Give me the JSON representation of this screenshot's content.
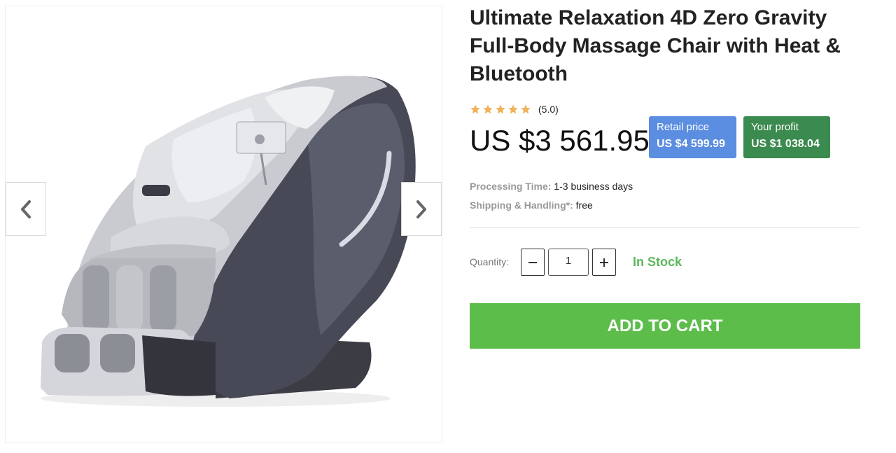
{
  "product": {
    "title": "Ultimate Relaxation 4D Zero Gravity Full-Body Massage Chair with Heat & Bluetooth",
    "rating": {
      "stars": 5,
      "text": "(5.0)"
    },
    "price": "US $3 561.95",
    "retail": {
      "label": "Retail price",
      "value": "US $4 599.99"
    },
    "profit": {
      "label": "Your profit",
      "value": "US $1 038.04"
    },
    "processing": {
      "label": "Processing Time:",
      "value": "1-3 business days"
    },
    "shipping": {
      "label": "Shipping & Handling*:",
      "value": "free"
    }
  },
  "purchase": {
    "quantity_label": "Quantity:",
    "quantity_value": "1",
    "stock": "In Stock",
    "add_to_cart": "ADD TO CART"
  },
  "gallery": {
    "image": "massage-chair-image",
    "prev_icon": "chevron-left-icon",
    "next_icon": "chevron-right-icon"
  },
  "colors": {
    "star": "#f0b35b",
    "retail_badge": "#5b8de1",
    "profit_badge": "#3b8a4f",
    "in_stock": "#5cb85c",
    "cart_button": "#5cbd4b"
  }
}
